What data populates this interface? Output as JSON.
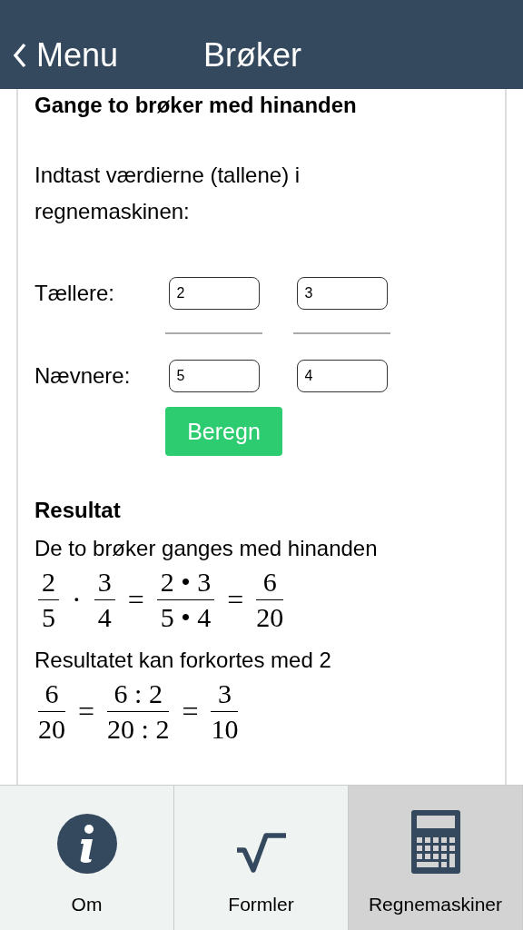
{
  "header": {
    "back_label": "Menu",
    "title": "Brøker"
  },
  "section_title": "Gange to brøker med hinanden",
  "instruction": "Indtast værdierne (tallene) i regnemaskinen:",
  "numerators": {
    "label": "Tællere:",
    "values": [
      "2",
      "3"
    ]
  },
  "denominators": {
    "label": "Nævnere:",
    "values": [
      "5",
      "4"
    ]
  },
  "calculate_button": "Beregn",
  "result": {
    "title": "Resultat",
    "steps": [
      {
        "text": "De to brøker ganges med hinanden",
        "equation": [
          {
            "kind": "fraction",
            "num": "2",
            "den": "5"
          },
          {
            "kind": "operator",
            "symbol": "·"
          },
          {
            "kind": "fraction",
            "num": "3",
            "den": "4"
          },
          {
            "kind": "operator",
            "symbol": "="
          },
          {
            "kind": "fraction",
            "num": "2 • 3",
            "den": "5 • 4"
          },
          {
            "kind": "operator",
            "symbol": "="
          },
          {
            "kind": "fraction",
            "num": "6",
            "den": "20"
          }
        ]
      },
      {
        "text": "Resultatet kan forkortes med 2",
        "equation": [
          {
            "kind": "fraction",
            "num": "6",
            "den": "20"
          },
          {
            "kind": "operator",
            "symbol": "="
          },
          {
            "kind": "fraction",
            "num": "6 : 2",
            "den": "20 : 2"
          },
          {
            "kind": "operator",
            "symbol": "="
          },
          {
            "kind": "fraction",
            "num": "3",
            "den": "10"
          }
        ]
      }
    ]
  },
  "tabs": [
    {
      "label": "Om",
      "selected": false
    },
    {
      "label": "Formler",
      "selected": false
    },
    {
      "label": "Regnemaskiner",
      "selected": true
    }
  ]
}
